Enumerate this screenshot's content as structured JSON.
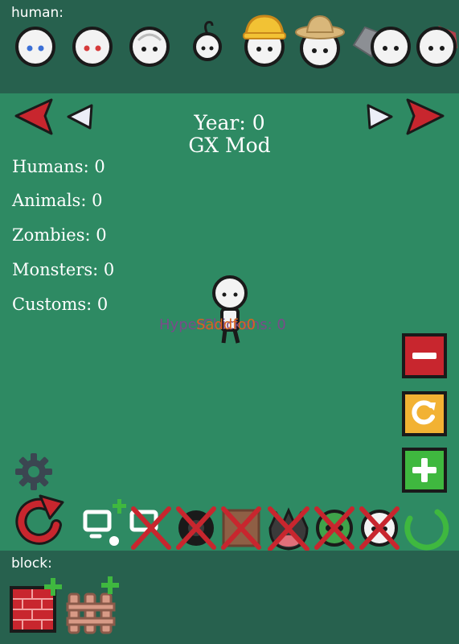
{
  "top_panel": {
    "label": "human:",
    "items": [
      {
        "name": "human-blue-eyes",
        "eye_color": "#3b6fd6"
      },
      {
        "name": "human-red-eyes",
        "eye_color": "#d63b3b"
      },
      {
        "name": "human-bald"
      },
      {
        "name": "human-child"
      },
      {
        "name": "human-hardhat",
        "hat_color": "#f2c234"
      },
      {
        "name": "human-strawhat",
        "hat_color": "#d9b77a"
      },
      {
        "name": "human-hooded"
      },
      {
        "name": "human-plain"
      }
    ]
  },
  "header": {
    "year_text": "Year: 0",
    "mod_text": "GX Mod"
  },
  "stats": [
    "Humans: 0",
    "Animals: 0",
    "Zombies: 0",
    "Monsters: 0",
    "Customs: 0"
  ],
  "overlapping_labels": {
    "hyper_label": "HyperChickens: 0",
    "orange_label": "Saddfo0"
  },
  "bottom_panel": {
    "label": "block:",
    "items": [
      "brick-block",
      "wood-fence-block"
    ]
  },
  "colors": {
    "background": "#2e8a63",
    "panel": "#27614e",
    "red_arrow": "#c8262e",
    "minus_button": "#c8262e",
    "refresh_button": "#f2b233",
    "plus_button": "#3fb83f",
    "cross": "#c8262e",
    "hyper_label": "#7b4b8a",
    "orange_label": "#d9641e"
  }
}
